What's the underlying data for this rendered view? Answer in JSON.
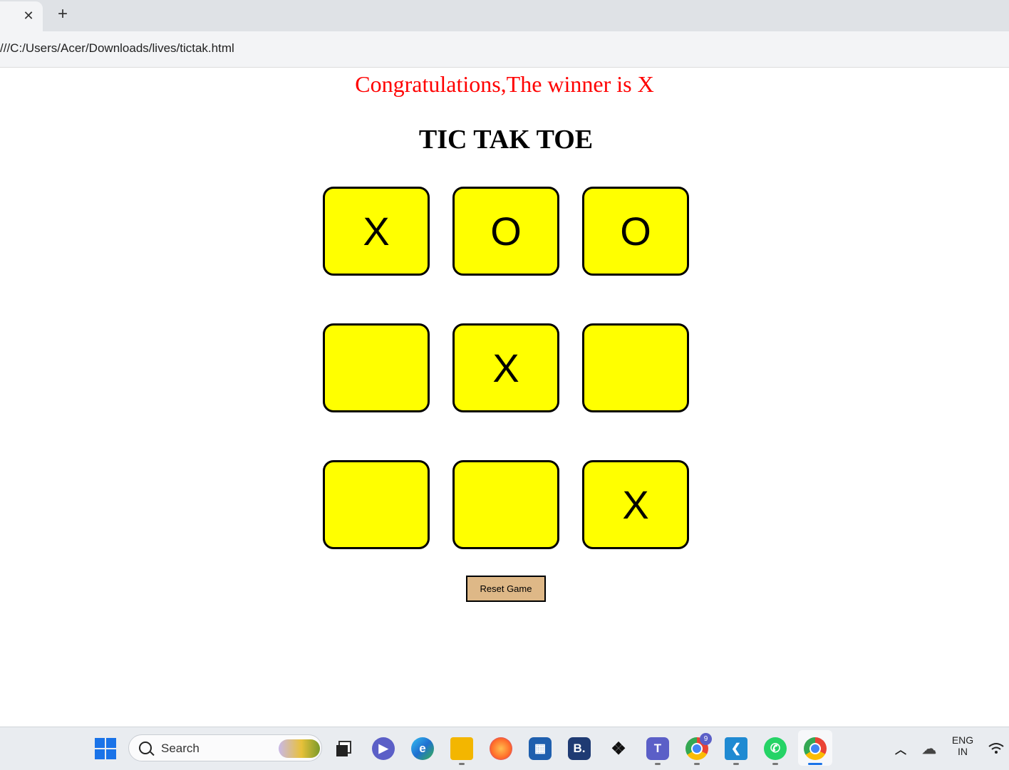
{
  "browser": {
    "tab_close_glyph": "✕",
    "new_tab_glyph": "+",
    "url": "///C:/Users/Acer/Downloads/lives/tictak.html"
  },
  "game": {
    "winner_message": "Congratulations,The winner is X",
    "title": "TIC TAK TOE",
    "cells": [
      "X",
      "O",
      "O",
      "",
      "X",
      "",
      "",
      "",
      "X"
    ],
    "reset_label": "Reset Game",
    "colors": {
      "cell_bg": "#ffff00",
      "reset_bg": "#deb887",
      "winner_text": "#ff0000"
    }
  },
  "taskbar": {
    "search_placeholder": "Search",
    "chrome_badge": "9",
    "language_line1": "ENG",
    "language_line2": "IN",
    "icons": [
      "start-icon",
      "search-icon",
      "task-view-icon",
      "meet-icon",
      "edge-icon",
      "file-explorer-icon",
      "firefox-icon",
      "store-icon",
      "bootstrap-icon",
      "dropbox-icon",
      "teams-icon",
      "chrome-icon",
      "vscode-icon",
      "whatsapp-icon",
      "chrome-icon",
      "chevron-up-icon",
      "onedrive-icon",
      "wifi-icon"
    ]
  }
}
